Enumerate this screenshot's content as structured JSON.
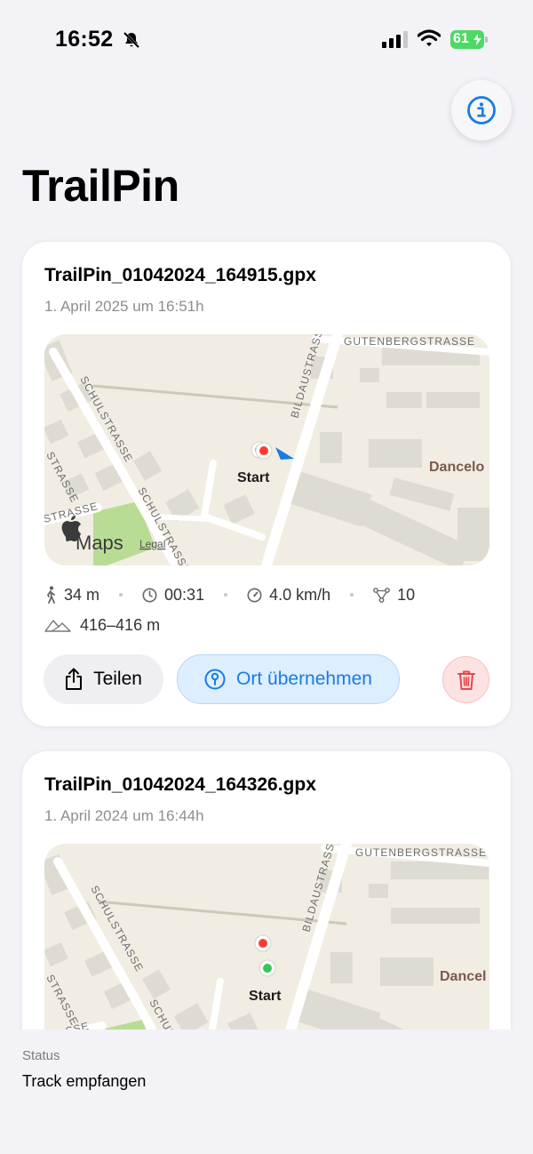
{
  "status_bar": {
    "time": "16:52",
    "battery": "61"
  },
  "app": {
    "title": "TrailPin"
  },
  "tracks": [
    {
      "file_name": "TrailPin_01042024_164915.gpx",
      "date": "1. April 2025 um 16:51h",
      "map": {
        "streets": [
          "SCHULSTRASSE",
          "SCHULSTRASSE",
          "BILDAUSTRASSE",
          "GUTENBERGSTRASSE",
          "STRASSE",
          "STRASSE"
        ],
        "poi": "Dancelo",
        "start_label": "Start",
        "logo": "Maps",
        "legal": "Legal"
      },
      "stats": {
        "distance": "34 m",
        "duration": "00:31",
        "speed": "4.0 km/h",
        "points": "10",
        "elevation": "416–416 m"
      },
      "buttons": {
        "share": "Teilen",
        "take_location": "Ort übernehmen"
      }
    },
    {
      "file_name": "TrailPin_01042024_164326.gpx",
      "date": "1. April 2024 um 16:44h",
      "map": {
        "streets": [
          "SCHULSTRASSE",
          "SCHUL",
          "BILDAUSTRASSE",
          "GUTENBERGSTRASSE",
          "STRASSE",
          "SSE"
        ],
        "poi": "Dancel",
        "start_label": "Start"
      }
    }
  ],
  "status_panel": {
    "label": "Status",
    "value": "Track empfangen"
  },
  "colors": {
    "accent": "#1a7be3",
    "danger": "#e5484d",
    "start_green": "#34c759",
    "end_red": "#ff3b30",
    "battery": "#4cd964"
  }
}
